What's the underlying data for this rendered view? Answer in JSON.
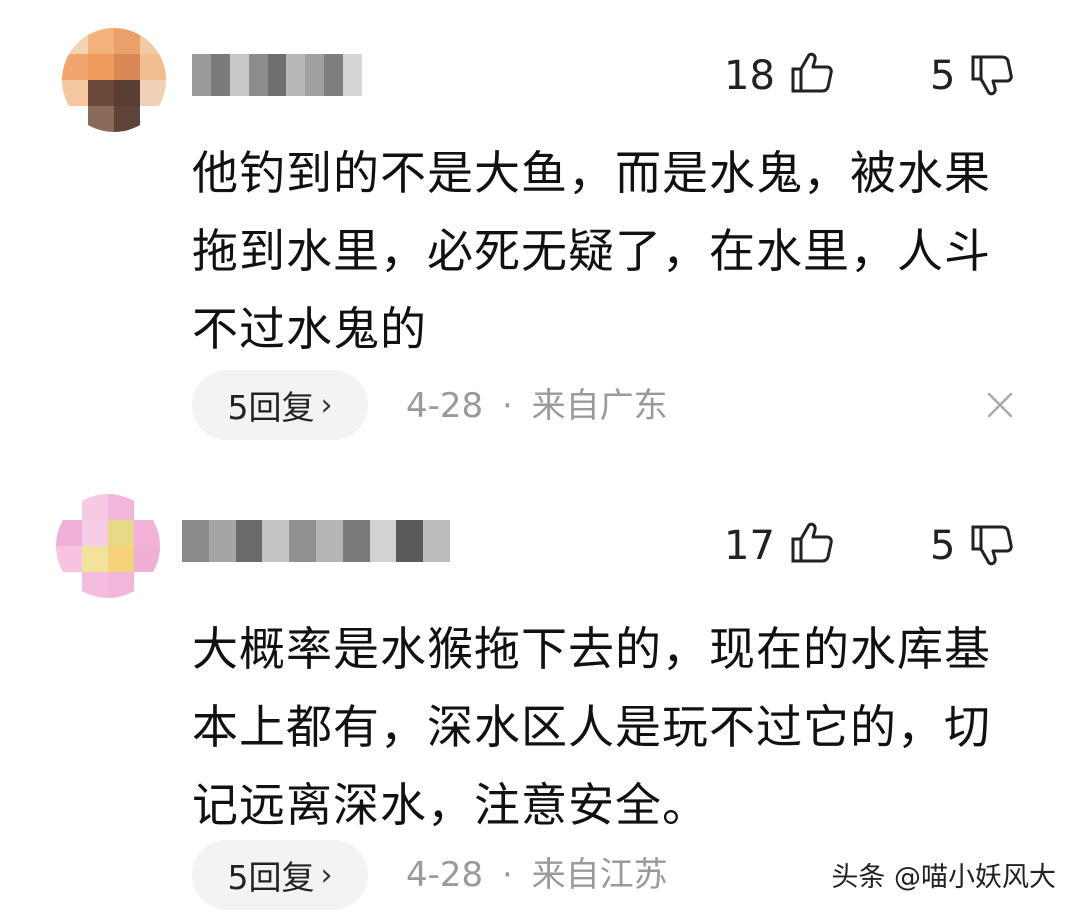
{
  "comments": [
    {
      "likes": "18",
      "dislikes": "5",
      "text": "他钓到的不是大鱼，而是水鬼，被水果拖到水里，必死无疑了，在水里，人斗不过水鬼的",
      "reply_label": "5回复",
      "date": "4-28",
      "separator": "·",
      "location": "来自广东",
      "avatar_icon": "blurred-avatar-icon",
      "avatar_palette": [
        "#f6d3b0",
        "#f2b27a",
        "#e9a06a",
        "#f3c9a2",
        "#f0a66d",
        "#ef9a5a",
        "#d88855",
        "#f2bd8f",
        "#f5c7a0",
        "#6b4a3a",
        "#5a3d32",
        "#f0d0b6",
        "#ffffff",
        "#8a6a5a",
        "#5e4438",
        "#ffffff"
      ],
      "username_palette": [
        "#9a9a9a",
        "#7a7a7a",
        "#c8c8c8",
        "#8c8c8c",
        "#6e6e6e",
        "#b8b8b8",
        "#a0a0a0",
        "#7e7e7e",
        "#d6d6d6"
      ]
    },
    {
      "likes": "17",
      "dislikes": "5",
      "text": "大概率是水猴拖下去的，现在的水库基本上都有，深水区人是玩不过它的，切记远离深水，注意安全。",
      "reply_label": "5回复",
      "date": "4-28",
      "separator": "·",
      "location": "来自江苏",
      "avatar_icon": "blurred-avatar-icon",
      "avatar_palette": [
        "#ffffff",
        "#f6c9e3",
        "#f2b6db",
        "#ffffff",
        "#f0b0d8",
        "#f5cde6",
        "#e8d98a",
        "#f3b3d8",
        "#f7c3e1",
        "#f1e39b",
        "#f5d27a",
        "#f0b0d6",
        "#ffffff",
        "#f4bcdf",
        "#f2b6da",
        "#ffffff"
      ],
      "username_palette": [
        "#8a8a8a",
        "#a5a5a5",
        "#6a6a6a",
        "#c4c4c4",
        "#909090",
        "#b5b5b5",
        "#7a7a7a",
        "#d2d2d2",
        "#5a5a5a",
        "#bcbcbc"
      ]
    }
  ],
  "watermark": "头条 @喵小妖风大",
  "icons": {
    "like": "thumbs-up-icon",
    "dislike": "thumbs-down-icon",
    "close": "close-icon",
    "chevron": "chevron-right-icon"
  },
  "chevron_glyph": "›"
}
